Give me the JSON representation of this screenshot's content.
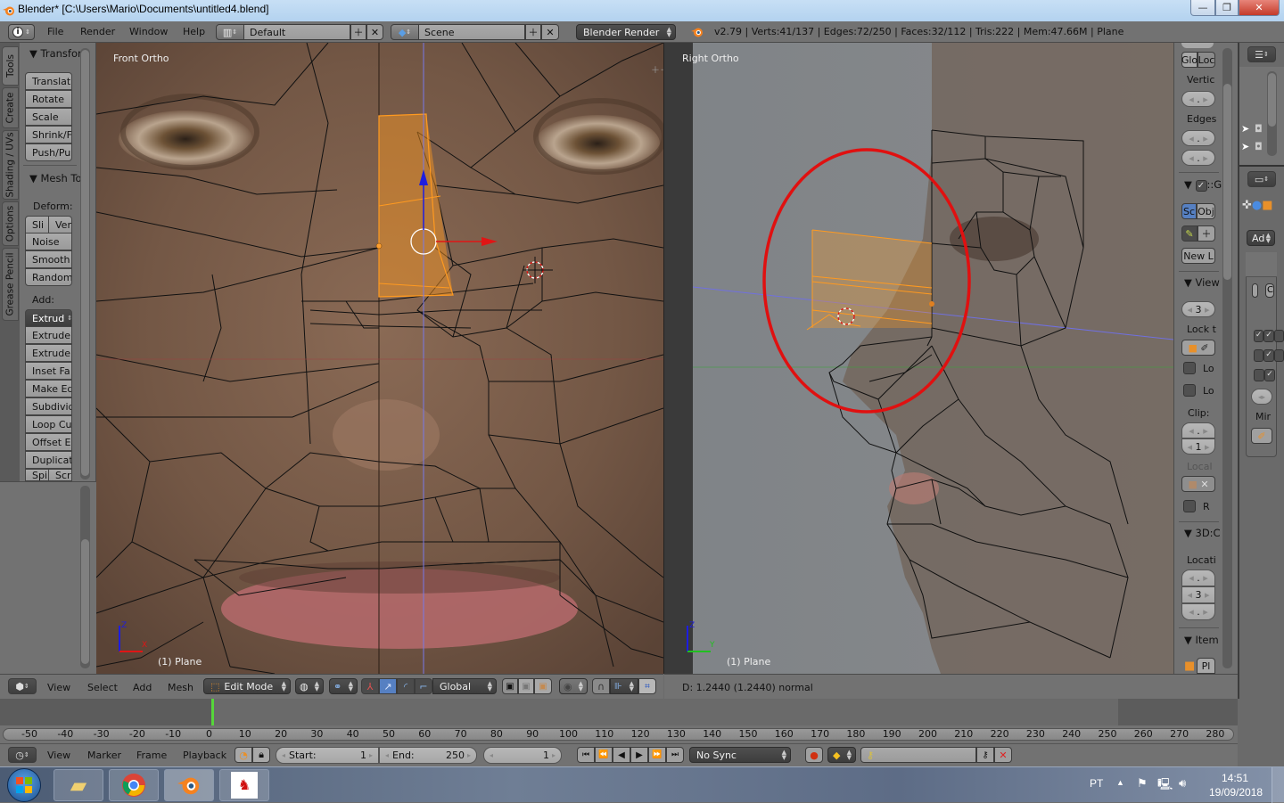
{
  "window": {
    "title": "Blender* [C:\\Users\\Mario\\Documents\\untitled4.blend]",
    "controls": {
      "minimize": "—",
      "restore": "❐",
      "close": "✕"
    }
  },
  "topbar": {
    "menus": [
      "File",
      "Render",
      "Window",
      "Help"
    ],
    "layout": "Default",
    "scene": "Scene",
    "engine": "Blender Render",
    "stats": "v2.79 | Verts:41/137 | Edges:72/250 | Faces:32/112 | Tris:222 | Mem:47.66M | Plane"
  },
  "tabs": [
    "Tools",
    "Create",
    "Shading / UVs",
    "Options",
    "Grease Pencil"
  ],
  "toolshelf": {
    "transform_header": "Transfor",
    "transform_buttons": [
      "Translat",
      "Rotate",
      "Scale",
      "Shrink/F",
      "Push/Pull"
    ],
    "mesh_header": "Mesh To",
    "deform_label": "Deform:",
    "deform_split": [
      "Sli",
      "Ver"
    ],
    "deform_buttons": [
      "Noise",
      "Smooth",
      "Randomi"
    ],
    "add_label": "Add:",
    "add_dropdown": "Extrud",
    "add_buttons": [
      "Extrude",
      "Extrude I",
      "Inset Fa",
      "Make Ed",
      "Subdivid",
      "Loop Cut",
      "Offset Ed",
      "Duplicat"
    ],
    "add_split": [
      "Spi",
      "Scr"
    ]
  },
  "viewports": {
    "left": {
      "label": "Front Ortho",
      "object": "(1) Plane",
      "axis1": "Z",
      "axis2": "X"
    },
    "right": {
      "label": "Right Ortho",
      "object": "(1) Plane",
      "axis1": "Z",
      "axis2": "Y"
    }
  },
  "npanel": {
    "glo": "Glo",
    "loc": "Loc",
    "vertices_label": "Vertic",
    "edges_label": "Edges",
    "grease_header": "::G",
    "sc": "Sc",
    "obj": "Obj",
    "new_layer": "New L",
    "view_header": "View",
    "lens_value": "3",
    "lock_label": "Lock t",
    "lock_cb1": "Lo",
    "lock_cb2": "Lo",
    "clip_label": "Clip:",
    "clip_start": ".",
    "clip_end": "1",
    "local_label": "Local",
    "render_cb": "R",
    "cursor_header": "3D:C",
    "location_label": "Locati",
    "loc_x": ".",
    "loc_y": "3",
    "loc_z": ".",
    "item_header": "Item",
    "item_name": "Pl",
    "empty_value": "."
  },
  "propcol": {
    "add_dropdown": "Ad",
    "mirror_label": "Mir",
    "modifier_field": "C"
  },
  "view3d_header": {
    "menus": [
      "View",
      "Select",
      "Add",
      "Mesh"
    ],
    "mode": "Edit Mode",
    "orientation": "Global"
  },
  "status": {
    "operator_info": "D: 1.2440 (1.2440) normal"
  },
  "timeline": {
    "ticks": [
      "-50",
      "-40",
      "-30",
      "-20",
      "-10",
      "0",
      "10",
      "20",
      "30",
      "40",
      "50",
      "60",
      "70",
      "80",
      "90",
      "100",
      "110",
      "120",
      "130",
      "140",
      "150",
      "160",
      "170",
      "180",
      "190",
      "200",
      "210",
      "220",
      "230",
      "240",
      "250",
      "260",
      "270",
      "280"
    ],
    "menus": [
      "View",
      "Marker",
      "Frame",
      "Playback"
    ],
    "start_label": "Start:",
    "start_value": "1",
    "end_label": "End:",
    "end_value": "250",
    "current_frame": "1",
    "sync": "No Sync"
  },
  "taskbar": {
    "language": "PT",
    "time": "14:51",
    "date": "19/09/2018"
  },
  "colors": {
    "selection": "#ff9a20",
    "x_axis": "#d42020",
    "z_axis": "#2020e0",
    "y_axis": "#20c020",
    "annotation_circle": "#e01010",
    "active_blue": "#5680c2"
  }
}
